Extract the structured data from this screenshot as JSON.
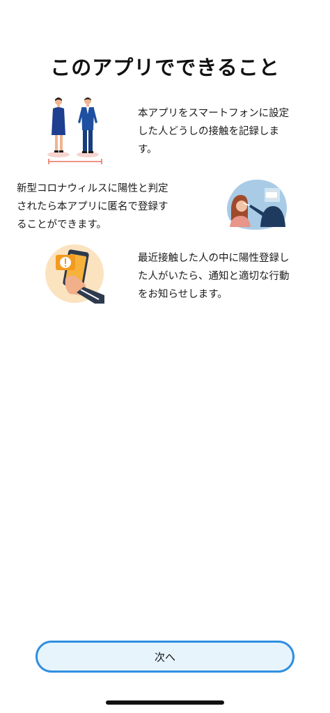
{
  "header": {
    "title": "このアプリでできること"
  },
  "features": [
    {
      "icon": "people-distance-icon",
      "lines": [
        "本アプリをスマートフォンに設定",
        "した人どうしの接触を記録しま",
        "す。"
      ]
    },
    {
      "icon": "covid-test-icon",
      "lines": [
        "新型コロナウィルスに陽性と判定",
        "されたら本アプリに匿名で登録す",
        "ることができます。"
      ]
    },
    {
      "icon": "phone-alert-icon",
      "lines": [
        "最近接触した人の中に陽性登録し",
        "た人がいたら、通知と適切な行動",
        "をお知らせします。"
      ]
    }
  ],
  "footer": {
    "next_label": "次へ"
  }
}
